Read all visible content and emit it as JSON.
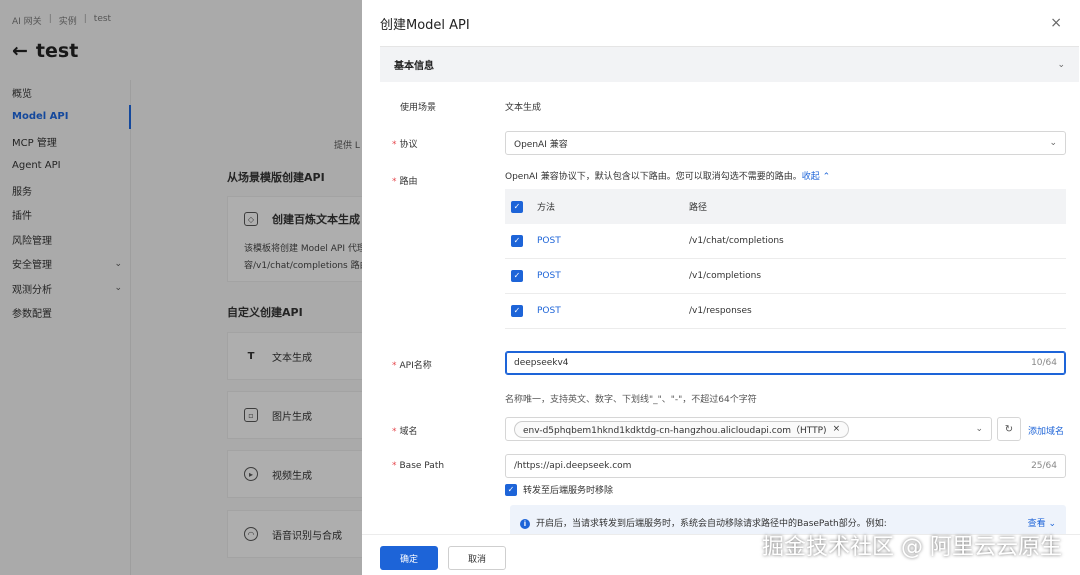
{
  "bg": {
    "breadcrumb": [
      "AI 网关",
      "实例",
      "test"
    ],
    "page_title": "test",
    "nav": [
      {
        "label": "概览",
        "active": false,
        "expand": false
      },
      {
        "label": "Model API",
        "active": true,
        "expand": false
      },
      {
        "label": "MCP 管理",
        "active": false,
        "expand": false
      },
      {
        "label": "Agent API",
        "active": false,
        "expand": false
      },
      {
        "label": "服务",
        "active": false,
        "expand": false
      },
      {
        "label": "插件",
        "active": false,
        "expand": false
      },
      {
        "label": "风险管理",
        "active": false,
        "expand": false
      },
      {
        "label": "安全管理",
        "active": false,
        "expand": true
      },
      {
        "label": "观测分析",
        "active": false,
        "expand": true
      },
      {
        "label": "参数配置",
        "active": false,
        "expand": false
      }
    ],
    "provide_text": "提供 L",
    "scene_heading": "从场景模版创建API",
    "template_card": {
      "title": "创建百炼文本生成",
      "desc_line1": "该模板将创建 Model API 代理",
      "desc_line2": "容/v1/chat/completions 路由,"
    },
    "custom_heading": "自定义创建API",
    "custom_items": [
      {
        "label": "文本生成",
        "icon": "text-T-icon"
      },
      {
        "label": "图片生成",
        "icon": "image-icon"
      },
      {
        "label": "视频生成",
        "icon": "video-icon"
      },
      {
        "label": "语音识别与合成",
        "icon": "headset-icon"
      }
    ]
  },
  "drawer": {
    "title": "创建Model API",
    "close_icon": "×",
    "section_title": "基本信息",
    "scene_label": "使用场景",
    "scene_value": "文本生成",
    "protocol": {
      "label": "协议",
      "value": "OpenAI 兼容"
    },
    "routes": {
      "label": "路由",
      "hint": "OpenAI 兼容协议下，默认包含以下路由。您可以取消勾选不需要的路由。",
      "collapse": "收起",
      "head_method": "方法",
      "head_path": "路径",
      "rows": [
        {
          "method": "POST",
          "path": "/v1/chat/completions",
          "checked": true
        },
        {
          "method": "POST",
          "path": "/v1/completions",
          "checked": true
        },
        {
          "method": "POST",
          "path": "/v1/responses",
          "checked": true
        }
      ]
    },
    "api_name": {
      "label": "API名称",
      "value": "deepseekv4",
      "counter": "10/64",
      "hint": "名称唯一，支持英文、数字、下划线\"_\"、\"-\"，不超过64个字符"
    },
    "domain": {
      "label": "域名",
      "tag": "env-d5phqbem1hknd1kdktdg-cn-hangzhou.alicloudapi.com（HTTP)",
      "add_link": "添加域名"
    },
    "base_path": {
      "label": "Base Path",
      "value": "/https://api.deepseek.com",
      "counter": "25/64"
    },
    "strip_checkbox": "转发至后端服务时移除",
    "info": {
      "text": "开启后，当请求转发到后端服务时，系统会自动移除请求路径中的BasePath部分。例如:",
      "link": "查看"
    },
    "confirm": "确定",
    "cancel": "取消"
  },
  "watermark": "掘金技术社区 @ 阿里云云原生",
  "colors": {
    "accent": "#1d64d8",
    "required": "#e5484d"
  }
}
